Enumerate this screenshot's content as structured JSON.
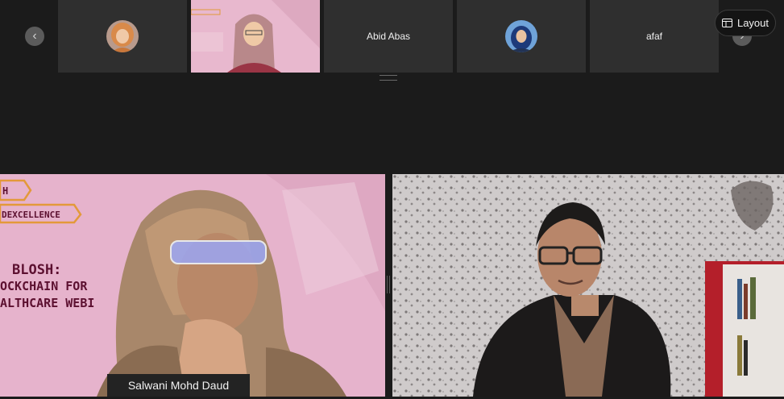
{
  "navigation": {
    "prev_icon": "chevron-left-icon",
    "next_icon": "chevron-right-icon"
  },
  "participants_strip": [
    {
      "type": "avatar"
    },
    {
      "type": "video"
    },
    {
      "type": "name",
      "name": "Abid Abas"
    },
    {
      "type": "avatar"
    },
    {
      "type": "name",
      "name": "afaf"
    }
  ],
  "layout_button": {
    "label": "Layout",
    "icon": "layout-icon"
  },
  "main_videos": {
    "left": {
      "speaker_name": "Salwani Mohd Daud",
      "slide": {
        "banner_1": "H",
        "banner_2": "DEXCELLENCE",
        "title_line_1": "BLOSH:",
        "title_line_2": "OCKCHAIN FOR",
        "title_line_3": "ALTHCARE WEBI"
      }
    },
    "right": {}
  },
  "colors": {
    "background": "#1b1b1b",
    "tile": "#2f2f2f",
    "slide_pink": "#e6b3cc",
    "label_bg": "#232323"
  }
}
